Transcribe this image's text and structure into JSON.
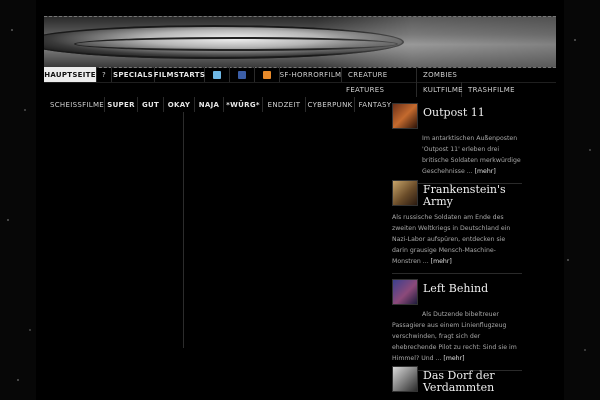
{
  "nav_top": [
    {
      "label": "Hauptseite",
      "active": true,
      "bold": true
    },
    {
      "label": "?",
      "bold": false
    },
    {
      "label": "Specials",
      "bold": true
    },
    {
      "label": "Filmstarts",
      "bold": true
    },
    {
      "icon": "twitter-icon"
    },
    {
      "icon": "facebook-icon"
    },
    {
      "icon": "rss-icon"
    },
    {
      "label": "SF-Horrorfilm",
      "bold": false
    },
    {
      "label": "Creature",
      "bold": false
    },
    {
      "label": "Zombies",
      "bold": false
    }
  ],
  "nav_top_second": [
    {
      "label": "Features"
    },
    {
      "label": "Kultfilme"
    },
    {
      "label": "Trashfilme"
    }
  ],
  "nav_sub": [
    {
      "label": "Scheissfilme",
      "bold": false
    },
    {
      "label": "Super",
      "bold": true
    },
    {
      "label": "Gut",
      "bold": true
    },
    {
      "label": "Okay",
      "bold": true
    },
    {
      "label": "Naja",
      "bold": true
    },
    {
      "label": "*Würg*",
      "bold": true
    },
    {
      "label": "Endzeit",
      "bold": false
    },
    {
      "label": "Cyberpunk",
      "bold": false
    },
    {
      "label": "Fantasy",
      "bold": false
    }
  ],
  "posts": [
    {
      "title": "Outpost 11",
      "excerpt": "Im antarktischen Außenposten 'Outpost 11' erleben drei britische Soldaten merkwürdige Geschehnisse ...",
      "more": "[mehr]"
    },
    {
      "title": "Frankenstein's Army",
      "excerpt": "Als russische Soldaten am Ende des zweiten Weltkriegs in Deutschland ein Nazi-Labor aufspüren, entdecken sie darin grausige Mensch-Maschine-Monstren ...",
      "more": "[mehr]"
    },
    {
      "title": "Left Behind",
      "excerpt": "Als Dutzende bibeltreuer Passagiere aus einem Linienflugzeug verschwinden, fragt sich der ehebrechende Pilot zu recht: Sind sie im Himmel? Und ...",
      "more": "[mehr]"
    },
    {
      "title": "Das Dorf der Verdammten",
      "excerpt": "",
      "more": ""
    }
  ]
}
